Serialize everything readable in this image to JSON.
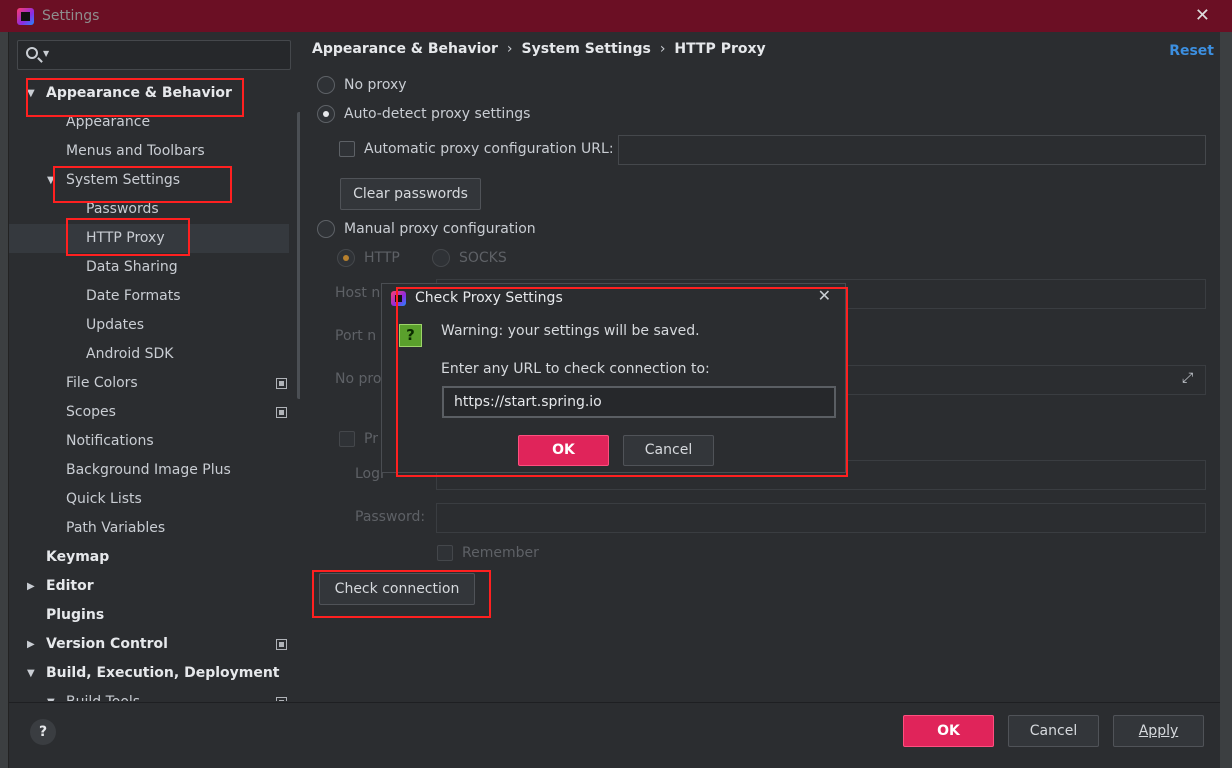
{
  "window": {
    "title": "Settings",
    "close_glyph": "✕"
  },
  "search": {
    "placeholder": "",
    "icon": "search-icon"
  },
  "sidebar": {
    "items": [
      {
        "label": "Appearance & Behavior",
        "bold": true,
        "arrow": "▼"
      },
      {
        "label": "Appearance"
      },
      {
        "label": "Menus and Toolbars"
      },
      {
        "label": "System Settings",
        "arrow": "▼"
      },
      {
        "label": "Passwords"
      },
      {
        "label": "HTTP Proxy",
        "selected": true
      },
      {
        "label": "Data Sharing"
      },
      {
        "label": "Date Formats"
      },
      {
        "label": "Updates"
      },
      {
        "label": "Android SDK"
      },
      {
        "label": "File Colors",
        "project_icon": true
      },
      {
        "label": "Scopes",
        "project_icon": true
      },
      {
        "label": "Notifications"
      },
      {
        "label": "Background Image Plus"
      },
      {
        "label": "Quick Lists"
      },
      {
        "label": "Path Variables"
      },
      {
        "label": "Keymap",
        "bold": true
      },
      {
        "label": "Editor",
        "bold": true,
        "arrow": "▶"
      },
      {
        "label": "Plugins",
        "bold": true
      },
      {
        "label": "Version Control",
        "bold": true,
        "arrow": "▶",
        "project_icon": true
      },
      {
        "label": "Build, Execution, Deployment",
        "bold": true,
        "arrow": "▼"
      },
      {
        "label": "Build Tools",
        "arrow": "▼",
        "project_icon": true
      }
    ]
  },
  "breadcrumb": {
    "part1": "Appearance & Behavior",
    "part2": "System Settings",
    "part3": "HTTP Proxy",
    "sep": "›"
  },
  "reset_label": "Reset",
  "proxy": {
    "no_proxy": "No proxy",
    "auto_detect": "Auto-detect proxy settings",
    "auto_config_url": "Automatic proxy configuration URL:",
    "clear_passwords": "Clear passwords",
    "manual": "Manual proxy configuration",
    "http": "HTTP",
    "socks": "SOCKS",
    "host_label": "Host n",
    "port_label": "Port n",
    "no_proxy_label": "No pro",
    "proxy_auth_label": "Pr",
    "login_label": "Logi",
    "password_label": "Password:",
    "remember": "Remember",
    "check_connection": "Check connection"
  },
  "dialog": {
    "title": "Check Proxy Settings",
    "close_glyph": "✕",
    "icon_glyph": "?",
    "warning": "Warning: your settings will be saved.",
    "prompt": "Enter any URL to check connection to:",
    "url_value": "https://start.spring.io",
    "ok": "OK",
    "cancel": "Cancel"
  },
  "footer": {
    "help": "?",
    "ok": "OK",
    "cancel": "Cancel",
    "apply": "Apply"
  },
  "colors": {
    "accent": "#e0245a",
    "link": "#3c8fe0",
    "title_bar": "#6b0f24",
    "annotation": "#ff2020"
  }
}
